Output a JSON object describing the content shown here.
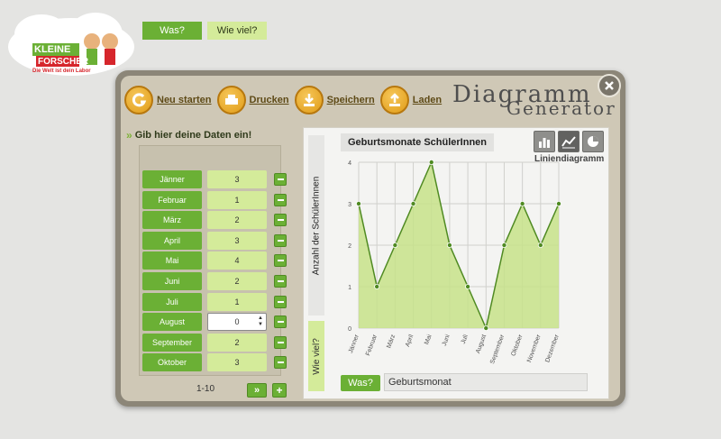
{
  "logo": {
    "line1": "KLEINE",
    "line2": "FORSCHER",
    "tagline": "Die Welt ist dein Labor"
  },
  "toolbar": {
    "items": [
      {
        "label": "Neu starten",
        "icon": "restart-icon"
      },
      {
        "label": "Drucken",
        "icon": "printer-icon"
      },
      {
        "label": "Speichern",
        "icon": "download-icon"
      },
      {
        "label": "Laden",
        "icon": "upload-icon"
      }
    ]
  },
  "app_title": {
    "line1": "Diagramm",
    "line2": "Generator"
  },
  "data_panel": {
    "heading": "Gib hier deine Daten ein!",
    "col_what": "Was?",
    "col_how_many": "Wie viel?",
    "rows": [
      {
        "label": "Jänner",
        "value": "3"
      },
      {
        "label": "Februar",
        "value": "1"
      },
      {
        "label": "März",
        "value": "2"
      },
      {
        "label": "April",
        "value": "3"
      },
      {
        "label": "Mai",
        "value": "4"
      },
      {
        "label": "Juni",
        "value": "2"
      },
      {
        "label": "Juli",
        "value": "1"
      },
      {
        "label": "August",
        "value": "0"
      },
      {
        "label": "September",
        "value": "2"
      },
      {
        "label": "Oktober",
        "value": "3"
      }
    ],
    "pager": "1-10",
    "next_label": "»",
    "add_label": "+"
  },
  "chart_panel": {
    "type_label": "Liniendiagramm",
    "y_axis_title": "Anzahl der SchülerInnen",
    "y_side_label": "Wie viel?",
    "x_button": "Was?",
    "x_field": "Geburtsmonat"
  },
  "colors": {
    "accent_green": "#6bb035",
    "light_green": "#d4eb9a",
    "area_fill": "#c7e28a",
    "toolbar_orange": "#e09b16"
  },
  "chart_data": {
    "type": "area",
    "title": "Geburtsmonate SchülerInnen",
    "xlabel": "",
    "ylabel": "Anzahl der SchülerInnen",
    "categories": [
      "Jänner",
      "Februar",
      "März",
      "April",
      "Mai",
      "Juni",
      "Juli",
      "August",
      "September",
      "Oktober",
      "November",
      "Dezember"
    ],
    "values": [
      3,
      1,
      2,
      3,
      4,
      2,
      1,
      0,
      2,
      3,
      2,
      3
    ],
    "ylim": [
      0,
      4
    ],
    "yticks": [
      0,
      1,
      2,
      3,
      4
    ],
    "grid": true
  }
}
